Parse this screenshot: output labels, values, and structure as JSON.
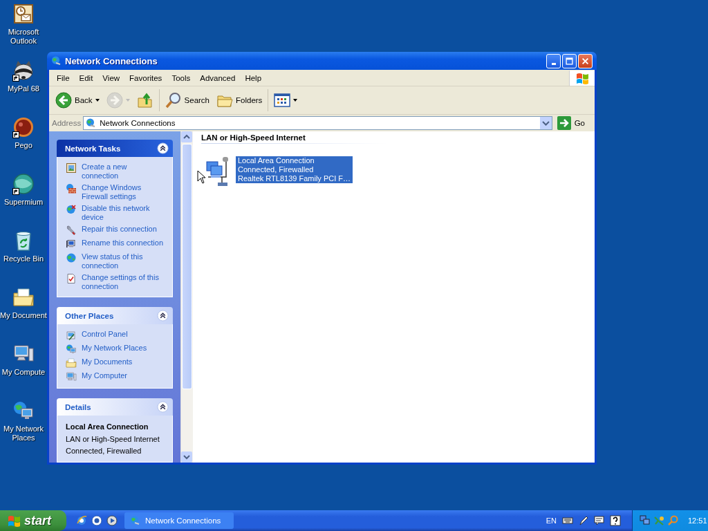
{
  "desktop_icons": [
    {
      "label": "Microsoft Outlook",
      "shortcut": false
    },
    {
      "label": "MyPal 68",
      "shortcut": true
    },
    {
      "label": "Pego",
      "shortcut": true
    },
    {
      "label": "Supermium",
      "shortcut": true
    },
    {
      "label": "Recycle Bin",
      "shortcut": false
    },
    {
      "label": "My Document",
      "shortcut": false
    },
    {
      "label": "My Compute",
      "shortcut": false
    },
    {
      "label": "My Network Places",
      "shortcut": false
    }
  ],
  "window": {
    "title": "Network Connections",
    "menu": [
      "File",
      "Edit",
      "View",
      "Favorites",
      "Tools",
      "Advanced",
      "Help"
    ],
    "toolbar": [
      {
        "kind": "back",
        "label": "Back",
        "dropdown": true,
        "disabled": false
      },
      {
        "kind": "forward",
        "dropdown": true,
        "disabled": true
      },
      {
        "kind": "up",
        "dropdown": false,
        "disabled": false
      },
      {
        "kind": "search",
        "label": "Search",
        "dropdown": false,
        "disabled": false
      },
      {
        "kind": "folders",
        "label": "Folders",
        "dropdown": false,
        "disabled": false
      },
      {
        "kind": "views",
        "dropdown": true,
        "disabled": false
      }
    ],
    "address": {
      "label": "Address",
      "value": "Network Connections",
      "go": "Go"
    },
    "task_panes": [
      {
        "title": "Network Tasks",
        "special": true,
        "expanded": true,
        "items": [
          {
            "label": "Create a new connection"
          },
          {
            "label": "Change Windows Firewall settings"
          },
          {
            "label": "Disable this network device"
          },
          {
            "label": "Repair this connection"
          },
          {
            "label": "Rename this connection"
          },
          {
            "label": "View status of this connection"
          },
          {
            "label": "Change settings of this connection"
          }
        ]
      },
      {
        "title": "Other Places",
        "special": false,
        "expanded": true,
        "items": [
          {
            "label": "Control Panel"
          },
          {
            "label": "My Network Places"
          },
          {
            "label": "My Documents"
          },
          {
            "label": "My Computer"
          }
        ]
      }
    ],
    "details": {
      "title": "Details",
      "expanded": true,
      "name": "Local Area Connection",
      "lines": [
        "LAN or High-Speed Internet",
        "Connected, Firewalled"
      ]
    },
    "groups": [
      {
        "heading": "LAN or High-Speed Internet",
        "items": [
          {
            "lines": [
              "Local Area Connection",
              "Connected, Firewalled",
              "Realtek RTL8139 Family PCI F…"
            ],
            "selected": true
          }
        ]
      }
    ]
  },
  "taskbar": {
    "start": "start",
    "tasks": [
      {
        "label": "Network Connections",
        "selected": false
      }
    ],
    "language": "EN",
    "clock": "12:51"
  }
}
